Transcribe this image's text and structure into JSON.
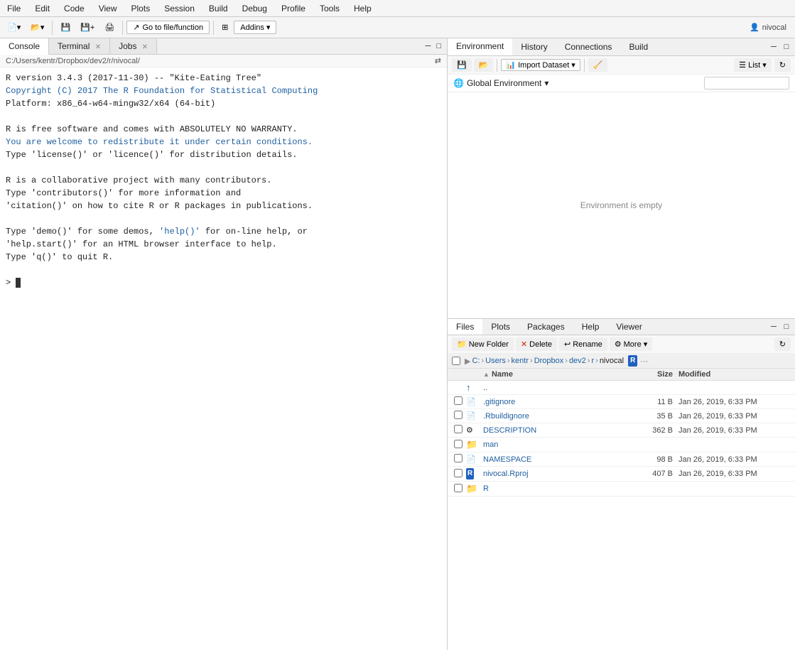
{
  "menubar": {
    "items": [
      "File",
      "Edit",
      "Code",
      "View",
      "Plots",
      "Session",
      "Build",
      "Debug",
      "Profile",
      "Tools",
      "Help"
    ]
  },
  "toolbar": {
    "goto_placeholder": "Go to file/function",
    "addins_label": "Addins",
    "user_label": "nivocal"
  },
  "left_panel": {
    "tabs": [
      {
        "label": "Console",
        "active": true
      },
      {
        "label": "Terminal",
        "active": false
      },
      {
        "label": "Jobs",
        "active": false
      }
    ],
    "path": "C:/Users/kentr/Dropbox/dev2/r/nivocal/",
    "console_output": [
      {
        "text": "R version 3.4.3 (2017-11-30) -- \"Kite-Eating Tree\"",
        "type": "normal"
      },
      {
        "text": "Copyright (C) 2017 The R Foundation for Statistical Computing",
        "type": "normal"
      },
      {
        "text": "Platform: x86_64-w64-mingw32/x64 (64-bit)",
        "type": "normal"
      },
      {
        "text": "",
        "type": "normal"
      },
      {
        "text": "R is free software and comes with ABSOLUTELY NO WARRANTY.",
        "type": "normal"
      },
      {
        "text": "You are welcome to redistribute it under certain conditions.",
        "type": "normal"
      },
      {
        "text": "Type 'license()' or 'licence()' for distribution details.",
        "type": "normal"
      },
      {
        "text": "",
        "type": "normal"
      },
      {
        "text": "R is a collaborative project with many contributors.",
        "type": "normal"
      },
      {
        "text": "Type 'contributors()' for more information and",
        "type": "normal"
      },
      {
        "text": "'citation()' on how to cite R or R packages in publications.",
        "type": "normal"
      },
      {
        "text": "",
        "type": "normal"
      },
      {
        "text": "Type 'demo()' for some demos, 'help()' for on-line help, or",
        "type": "normal"
      },
      {
        "text": "'help.start()' for an HTML browser interface to help.",
        "type": "normal"
      },
      {
        "text": "Type 'q()' to quit R.",
        "type": "normal"
      },
      {
        "text": "",
        "type": "normal"
      }
    ],
    "prompt": ">"
  },
  "env_panel": {
    "tabs": [
      "Environment",
      "History",
      "Connections",
      "Build"
    ],
    "active_tab": "Environment",
    "toolbar": {
      "save_title": "Save",
      "import_label": "Import Dataset",
      "broom_title": "Clear console"
    },
    "scope": "Global Environment",
    "search_placeholder": "",
    "empty_message": "Environment is empty"
  },
  "files_panel": {
    "tabs": [
      "Files",
      "Plots",
      "Packages",
      "Help",
      "Viewer"
    ],
    "active_tab": "Files",
    "toolbar": {
      "new_folder": "New Folder",
      "delete": "Delete",
      "rename": "Rename",
      "more": "More"
    },
    "breadcrumb": [
      "C:",
      "Users",
      "kentr",
      "Dropbox",
      "dev2",
      "r",
      "nivocal"
    ],
    "header": {
      "name": "Name",
      "size": "Size",
      "modified": "Modified"
    },
    "files": [
      {
        "name": "..",
        "type": "parent",
        "size": "",
        "modified": "",
        "icon": "up"
      },
      {
        "name": ".gitignore",
        "type": "file",
        "size": "11 B",
        "modified": "Jan 26, 2019, 6:33 PM",
        "icon": "text"
      },
      {
        "name": ".Rbuildignore",
        "type": "file",
        "size": "35 B",
        "modified": "Jan 26, 2019, 6:33 PM",
        "icon": "text"
      },
      {
        "name": "DESCRIPTION",
        "type": "file",
        "size": "362 B",
        "modified": "Jan 26, 2019, 6:33 PM",
        "icon": "gear"
      },
      {
        "name": "man",
        "type": "folder",
        "size": "",
        "modified": "",
        "icon": "folder"
      },
      {
        "name": "NAMESPACE",
        "type": "file",
        "size": "98 B",
        "modified": "Jan 26, 2019, 6:33 PM",
        "icon": "text"
      },
      {
        "name": "nivocal.Rproj",
        "type": "file",
        "size": "407 B",
        "modified": "Jan 26, 2019, 6:33 PM",
        "icon": "rproj"
      },
      {
        "name": "R",
        "type": "folder",
        "size": "",
        "modified": "",
        "icon": "folder"
      }
    ]
  }
}
